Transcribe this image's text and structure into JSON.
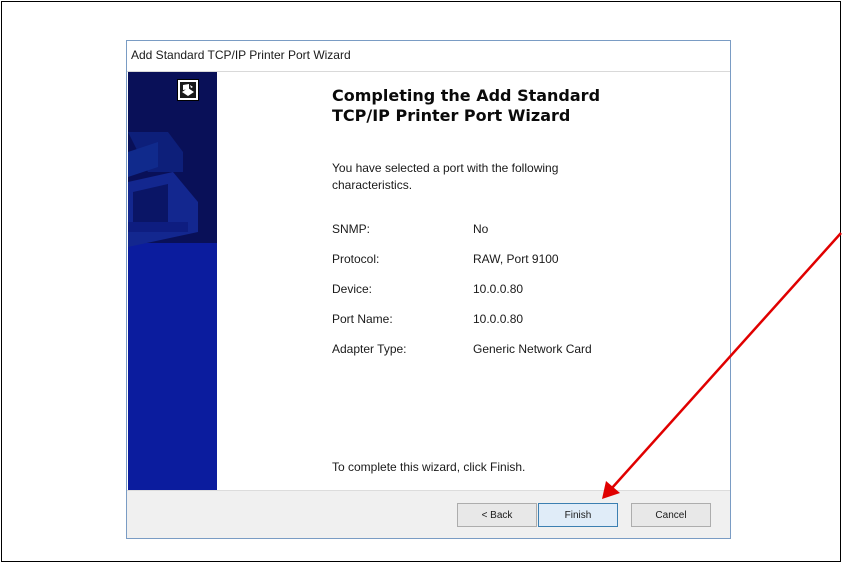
{
  "window": {
    "title": "Add Standard TCP/IP Printer Port Wizard"
  },
  "page": {
    "heading_line1": "Completing the Add Standard",
    "heading_line2": "TCP/IP Printer Port Wizard",
    "intro_line1": "You have selected a port with the following",
    "intro_line2": "characteristics.",
    "properties": [
      {
        "label": "SNMP:",
        "value": "No"
      },
      {
        "label": "Protocol:",
        "value": "RAW, Port 9100"
      },
      {
        "label": "Device:",
        "value": "10.0.0.80"
      },
      {
        "label": "Port Name:",
        "value": "10.0.0.80"
      },
      {
        "label": "Adapter Type:",
        "value": "Generic Network Card"
      }
    ],
    "completion_text": "To complete this wizard, click Finish."
  },
  "buttons": {
    "back": "< Back",
    "finish": "Finish",
    "cancel": "Cancel"
  },
  "icons": {
    "banner_logo": "printer-wizard-icon",
    "annotation": "red-arrow-annotation"
  },
  "colors": {
    "banner": "#0b1c9e",
    "banner_dark": "#091058",
    "arrow": "#e00000",
    "primary_button_border": "#3c7fb1"
  }
}
